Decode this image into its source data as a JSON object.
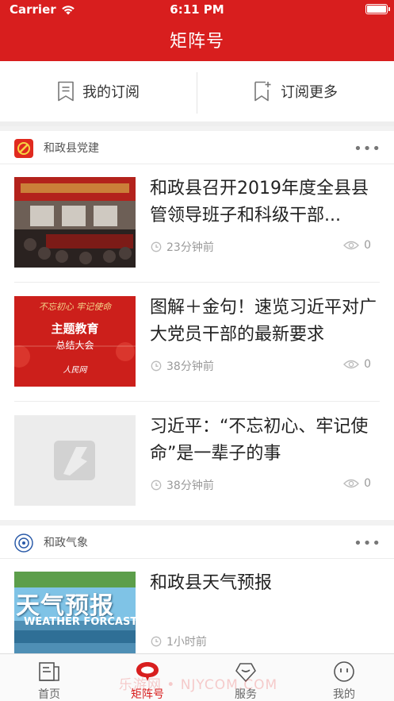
{
  "status_bar": {
    "carrier": "Carrier",
    "time": "6:11 PM"
  },
  "nav": {
    "title": "矩阵号"
  },
  "subscribe_bar": {
    "my_subscriptions": "我的订阅",
    "subscribe_more": "订阅更多"
  },
  "sections": [
    {
      "name": "和政县党建",
      "more": "•••",
      "articles": [
        {
          "title": "和政县召开2019年度全县县管领导班子和科级干部...",
          "time": "23分钟前",
          "views": "0"
        },
        {
          "title": "图解＋金句！速览习近平对广大党员干部的最新要求",
          "time": "38分钟前",
          "views": "0",
          "thumb": {
            "line1": "不忘初心 牢记使命",
            "line2": "主题教育",
            "line3": "总结大会",
            "brand": "人民网"
          }
        },
        {
          "title": "习近平：“不忘初心、牢记使命”是一辈子的事",
          "time": "38分钟前",
          "views": "0"
        }
      ]
    },
    {
      "name": "和政气象",
      "more": "•••",
      "articles": [
        {
          "title": "和政县天气预报",
          "time": "1小时前",
          "thumb": {
            "line1": "天气预报",
            "line2": "WEATHER FORCAST"
          }
        }
      ]
    }
  ],
  "tabbar": {
    "tabs": [
      {
        "label": "首页"
      },
      {
        "label": "矩阵号"
      },
      {
        "label": "服务"
      },
      {
        "label": "我的"
      }
    ]
  },
  "watermark": "乐游网 • NJYCOM.COM",
  "colors": {
    "brand_red": "#d81e1e",
    "meta_gray": "#9a9a9a"
  }
}
